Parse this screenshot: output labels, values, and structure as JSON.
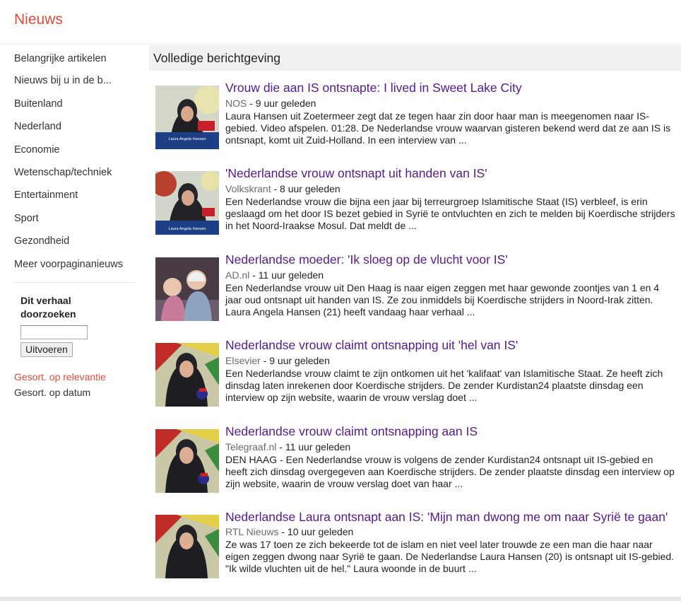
{
  "header": {
    "brand": "Nieuws"
  },
  "sidebar": {
    "items": [
      {
        "label": "Belangrijke artikelen"
      },
      {
        "label": "Nieuws bij u in de b..."
      },
      {
        "label": "Buitenland"
      },
      {
        "label": "Nederland"
      },
      {
        "label": "Economie"
      },
      {
        "label": "Wetenschap/techniek"
      },
      {
        "label": "Entertainment"
      },
      {
        "label": "Sport"
      },
      {
        "label": "Gezondheid"
      },
      {
        "label": "Meer voorpaginanieuws"
      }
    ],
    "search": {
      "label_line1": "Dit verhaal",
      "label_line2": "doorzoeken",
      "value": "",
      "button_label": "Uitvoeren"
    },
    "sort": {
      "relevance_label": "Gesort. op relevantie",
      "date_label": "Gesort. op datum",
      "active_color": "#dd4b39"
    }
  },
  "main": {
    "section_title": "Volledige berichtgeving",
    "articles": [
      {
        "title": "Vrouw die aan IS ontsnapte: I lived in Sweet Lake City",
        "source": "NOS",
        "separator": " - ",
        "time": "9 uur geleden",
        "snippet": "Laura Hansen uit Zoetermeer zegt dat ze tegen haar zin door haar man is meegenomen naar IS-gebied. Video afspelen. 01:28. De Nederlandse vrouw waarvan gisteren bekend werd dat ze aan IS is ontsnapt, komt uit Zuid-Holland. In een interview van ...",
        "thumb_caption": "Laura Angela Hansen"
      },
      {
        "title": "'Nederlandse vrouw ontsnapt uit handen van IS'",
        "source": "Volkskrant",
        "separator": " - ",
        "time": "8 uur geleden",
        "snippet": "Een Nederlandse vrouw die bijna een jaar bij terreurgroep Islamitische Staat (IS) verbleef, is erin geslaagd om het door IS bezet gebied in Syrië te ontvluchten en zich te melden bij Koerdische strijders in het Noord-Iraakse Mosul. Dat meldt de ...",
        "thumb_caption": "Laura Angela Hansen"
      },
      {
        "title": "Nederlandse moeder: 'Ik sloeg op de vlucht voor IS'",
        "source": "AD.nl",
        "separator": " - ",
        "time": "11 uur geleden",
        "snippet": "Een Nederlandse vrouw uit Den Haag is naar eigen zeggen met haar gewonde zoontjes van 1 en 4 jaar oud ontsnapt uit handen van IS. Ze zou inmiddels bij Koerdische strijders in Noord-Irak zitten. Laura Angela Hansen (21) heeft vandaag haar verhaal ...",
        "thumb_caption": ""
      },
      {
        "title": "Nederlandse vrouw claimt ontsnapping uit 'hel van IS'",
        "source": "Elsevier",
        "separator": " - ",
        "time": "9 uur geleden",
        "snippet": "Een Nederlandse vrouw claimt te zijn ontkomen uit het 'kalifaat' van Islamitische Staat. Ze heeft zich dinsdag laten inrekenen door Koerdische strijders. De zender Kurdistan24 plaatste dinsdag een interview op zijn website, waarin de vrouw verslag doet ...",
        "thumb_caption": ""
      },
      {
        "title": "Nederlandse vrouw claimt ontsnapping aan IS",
        "source": "Telegraaf.nl",
        "separator": " - ",
        "time": "11 uur geleden",
        "snippet": "DEN HAAG - Een Nederlandse vrouw is volgens de zender Kurdistan24 ontsnapt uit IS-gebied en heeft zich dinsdag overgegeven aan Koerdische strijders. De zender plaatste dinsdag een interview op zijn website, waarin de vrouw verslag doet van haar ...",
        "thumb_caption": ""
      },
      {
        "title": "Nederlandse Laura ontsnapt aan IS: 'Mijn man dwong me om naar Syrië te gaan'",
        "source": "RTL Nieuws",
        "separator": " - ",
        "time": "10 uur geleden",
        "snippet": "Ze was 17 toen ze zich bekeerde tot de islam en niet veel later trouwde ze een man die haar naar eigen zeggen dwong naar Syrië te gaan. De Nederlandse Laura Hansen (20) is ontsnapt uit IS-gebied. \"Ik wilde vluchten uit de hel.\" Laura woonde in de buurt ...",
        "thumb_caption": ""
      }
    ]
  },
  "colors": {
    "brand": "#dd4b39",
    "title_link": "#551a8b",
    "source": "#6a6a6a",
    "header_band": "#f1f1f1"
  }
}
